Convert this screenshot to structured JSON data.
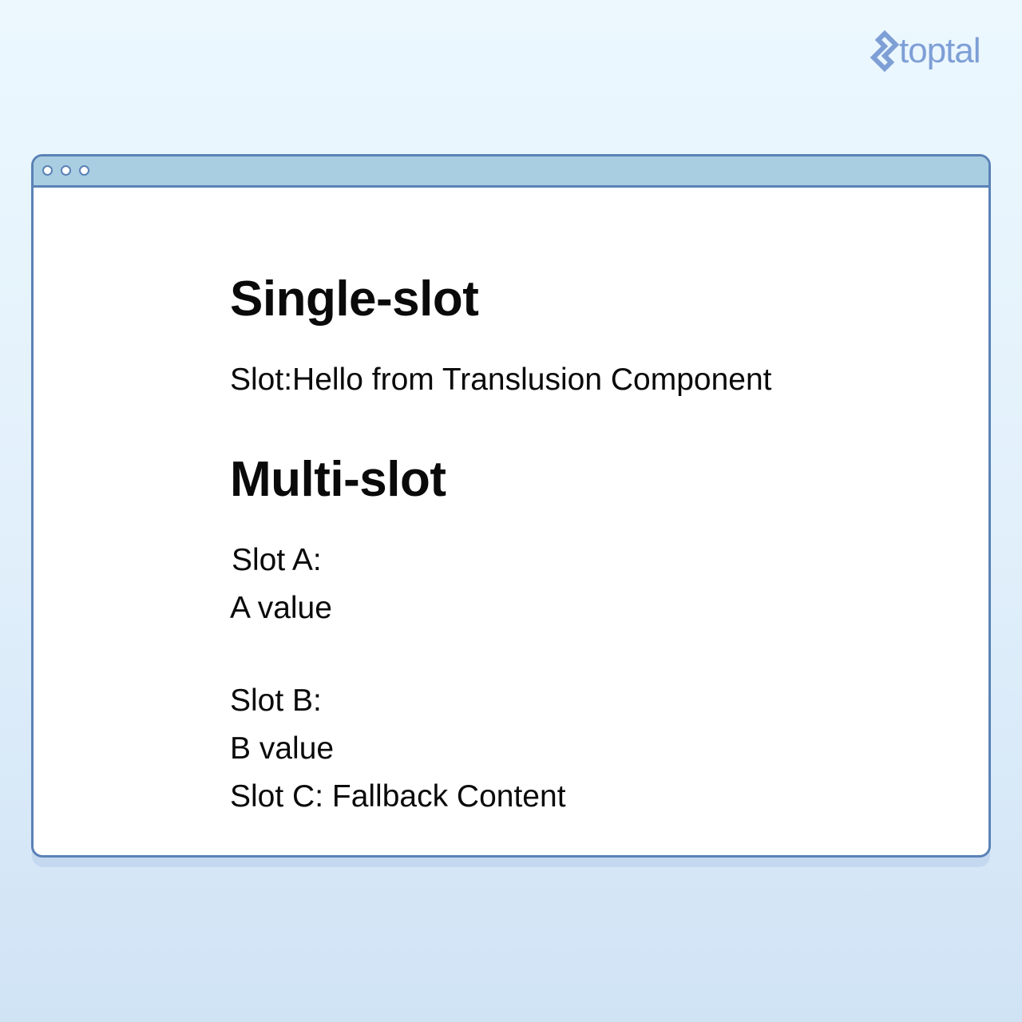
{
  "brand": {
    "name": "toptal",
    "color": "#7e9fd6"
  },
  "window": {
    "titlebar_color": "#a9cde1",
    "border_color": "#5a82b6"
  },
  "content": {
    "single_heading": "Single-slot",
    "single_slot_text": "Slot:Hello from Translusion Component",
    "multi_heading": "Multi-slot",
    "slot_a_label": "Slot A:",
    "slot_a_value": "A value",
    "slot_b_label": "Slot B:",
    "slot_b_value": "B value",
    "slot_c_text": "Slot C: Fallback Content"
  }
}
